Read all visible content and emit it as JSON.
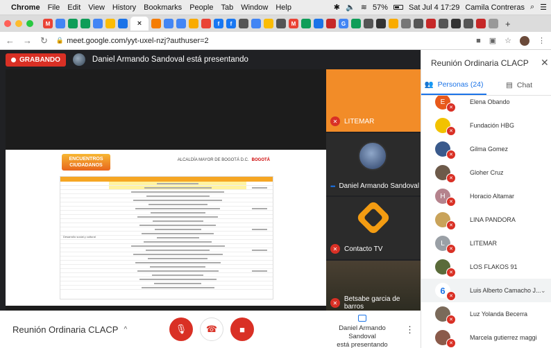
{
  "menubar": {
    "apple": "",
    "app": "Chrome",
    "items": [
      "File",
      "Edit",
      "View",
      "History",
      "Bookmarks",
      "People",
      "Tab",
      "Window",
      "Help"
    ],
    "battery": "57%",
    "datetime": "Sat Jul 4  17:29",
    "user": "Camila Contreras"
  },
  "toolbar": {
    "url": "meet.google.com/yyt-uxel-nzj?authuser=2"
  },
  "meet": {
    "recording_label": "GRABANDO",
    "presenter_text": "Daniel Armando Sandoval está presentando",
    "slide": {
      "logo_line1": "ENCUENTROS",
      "logo_line2": "CIUDADANOS",
      "logo_right1": "ALCALDÍA MAYOR DE BOGOTÁ D.C.",
      "logo_right2": "BOGOTÁ",
      "row_label": "Desarrollo social y cultural"
    },
    "tiles": [
      {
        "name": "LITEMAR",
        "muted": true
      },
      {
        "name": "Daniel Armando Sandoval",
        "muted": false
      },
      {
        "name": "Contacto TV",
        "muted": true
      },
      {
        "name": "Betsabe garcia de barros",
        "muted": true
      }
    ],
    "bottom": {
      "meeting_title": "Reunión Ordinaria CLACP",
      "presenting_line1": "Daniel Armando Sandoval",
      "presenting_line2": "está presentando"
    }
  },
  "panel": {
    "title": "Reunión Ordinaria CLACP",
    "tab_people": "Personas (24)",
    "tab_chat": "Chat",
    "people": [
      {
        "name": "Elena Obando",
        "initial": "E",
        "color": "#e8591a"
      },
      {
        "name": "Fundación HBG",
        "initial": "",
        "color": "#f2c200"
      },
      {
        "name": "Gilma Gomez",
        "initial": "",
        "color": "#3a5a8c"
      },
      {
        "name": "Gloher Cruz",
        "initial": "",
        "color": "#6d5a4a"
      },
      {
        "name": "Horacio Altamar",
        "initial": "H",
        "color": "#b5838d"
      },
      {
        "name": "LINA PANDORA",
        "initial": "",
        "color": "#c9a35a"
      },
      {
        "name": "LITEMAR",
        "initial": "L",
        "color": "#9aa0a6"
      },
      {
        "name": "LOS FLAKOS 91",
        "initial": "",
        "color": "#5a6b3a"
      },
      {
        "name": "Luis Alberto Camacho J...",
        "initial": "6",
        "color": "#ffffff"
      },
      {
        "name": "Luz Yolanda Becerra",
        "initial": "",
        "color": "#7a6a5a"
      },
      {
        "name": "Marcela gutierrez maggi",
        "initial": "",
        "color": "#8a5a4a"
      }
    ]
  }
}
